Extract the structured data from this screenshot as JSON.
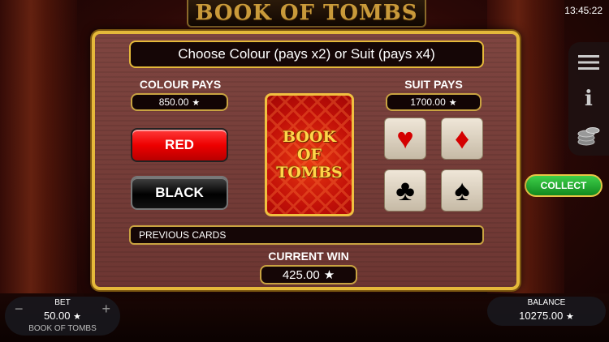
{
  "header": {
    "logo_text": "BOOK OF TOMBS",
    "clock": "13:45:22"
  },
  "side_menu": {
    "menu_icon": "hamburger-icon",
    "info_icon": "info-icon",
    "chips_icon": "coins-stack-icon"
  },
  "collect_label": "COLLECT",
  "gamble": {
    "banner": "Choose Colour (pays x2) or Suit (pays x4)",
    "colour_pays_label": "COLOUR PAYS",
    "colour_pays_value": "850.00",
    "suit_pays_label": "SUIT PAYS",
    "suit_pays_value": "1700.00",
    "red_label": "RED",
    "black_label": "BLACK",
    "card_text_line1": "BOOK",
    "card_text_line2": "OF",
    "card_text_line3": "TOMBS",
    "suits": [
      {
        "name": "hearts",
        "glyph": "♥"
      },
      {
        "name": "diamonds",
        "glyph": "♦"
      },
      {
        "name": "clubs",
        "glyph": "♣"
      },
      {
        "name": "spades",
        "glyph": "♠"
      }
    ],
    "previous_cards_label": "PREVIOUS CARDS",
    "current_win_label": "CURRENT WIN",
    "current_win_value": "425.00"
  },
  "bet": {
    "label": "BET",
    "value": "50.00",
    "game_name": "BOOK OF TOMBS",
    "minus": "−",
    "plus": "+"
  },
  "balance": {
    "label": "BALANCE",
    "value": "10275.00"
  },
  "star_glyph": "★",
  "colors": {
    "gold": "#e5b93a",
    "red_button": "#e00000",
    "collect_green": "#1fa52a"
  }
}
